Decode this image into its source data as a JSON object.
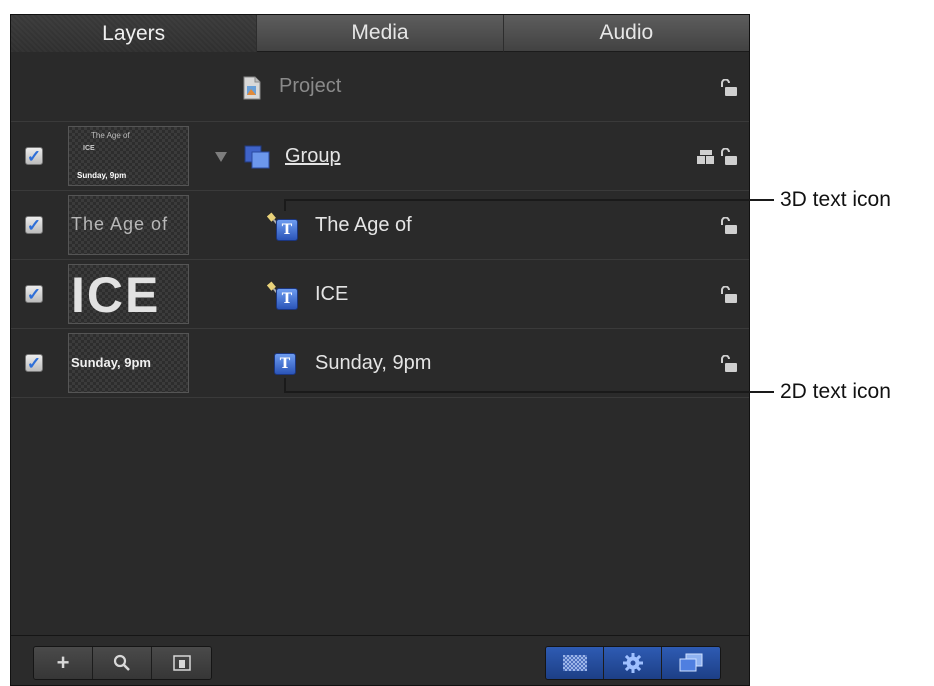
{
  "tabs": [
    {
      "label": "Layers",
      "active": true
    },
    {
      "label": "Media",
      "active": false
    },
    {
      "label": "Audio",
      "active": false
    }
  ],
  "project": {
    "label": "Project"
  },
  "layers": [
    {
      "label": "Group",
      "thumb_lines": [
        "The Age of",
        "ICE",
        "Sunday, 9pm"
      ],
      "checked": true
    },
    {
      "label": "The Age of",
      "thumb_text": "The Age of",
      "checked": true,
      "icon": "3d-text-icon"
    },
    {
      "label": "ICE",
      "thumb_text": "ICE",
      "checked": true,
      "icon": "3d-text-icon"
    },
    {
      "label": "Sunday, 9pm",
      "thumb_text": "Sunday, 9pm",
      "checked": true,
      "icon": "2d-text-icon"
    }
  ],
  "callouts": {
    "three_d": "3D text icon",
    "two_d": "2D text icon"
  },
  "bottombar": {
    "add_label": "+",
    "icons": [
      "add-icon",
      "search-icon",
      "thumbnail-view-icon",
      "checkerboard-icon",
      "gear-icon",
      "layers-icon"
    ]
  },
  "colors": {
    "panel_bg": "#2a2a2a",
    "accent_blue": "#2e5bb3",
    "checkmark": "#2e6fd8"
  }
}
